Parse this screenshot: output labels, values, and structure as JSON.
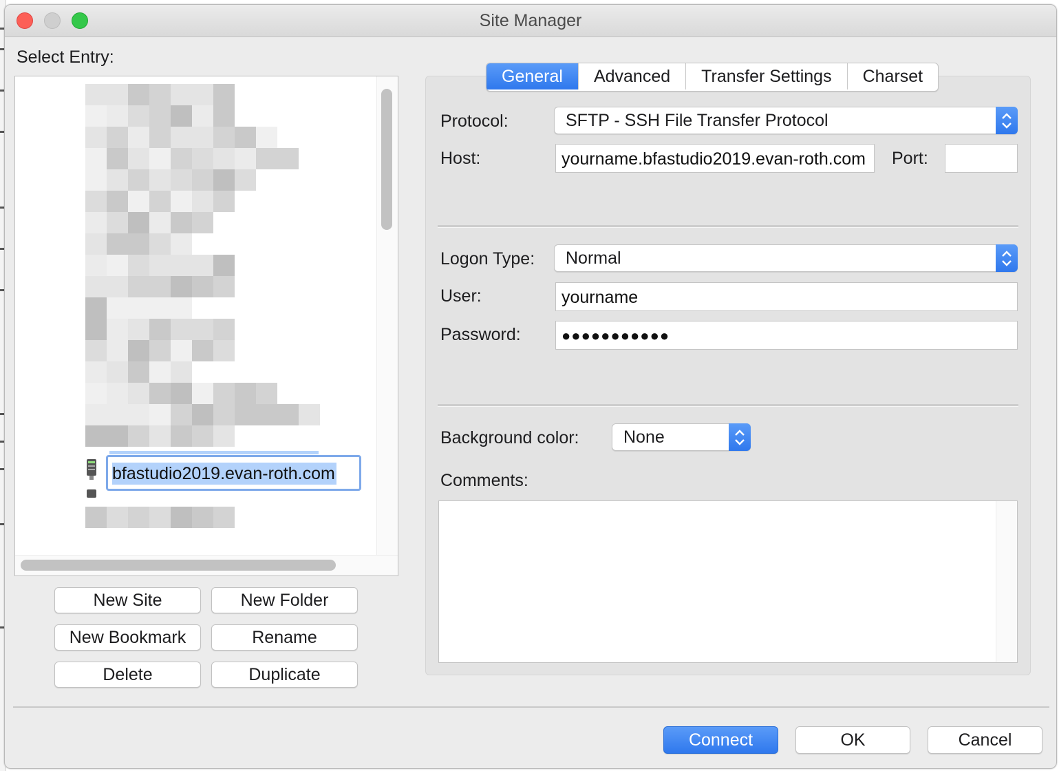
{
  "window": {
    "title": "Site Manager"
  },
  "left": {
    "select_entry_label": "Select Entry:",
    "editing_entry": "bfastudio2019.evan-roth.com"
  },
  "buttons": {
    "new_site": "New Site",
    "new_folder": "New Folder",
    "new_bookmark": "New Bookmark",
    "rename": "Rename",
    "delete": "Delete",
    "duplicate": "Duplicate"
  },
  "tabs": [
    {
      "label": "General",
      "active": true
    },
    {
      "label": "Advanced",
      "active": false
    },
    {
      "label": "Transfer Settings",
      "active": false
    },
    {
      "label": "Charset",
      "active": false
    }
  ],
  "general": {
    "protocol_label": "Protocol:",
    "protocol_value": "SFTP - SSH File Transfer Protocol",
    "host_label": "Host:",
    "host_value": "yourname.bfastudio2019.evan-roth.com",
    "port_label": "Port:",
    "port_value": "",
    "logon_type_label": "Logon Type:",
    "logon_type_value": "Normal",
    "user_label": "User:",
    "user_value": "yourname",
    "password_label": "Password:",
    "password_value": "●●●●●●●●●●●",
    "bg_color_label": "Background color:",
    "bg_color_value": "None",
    "comments_label": "Comments:",
    "comments_value": ""
  },
  "footer": {
    "connect": "Connect",
    "ok": "OK",
    "cancel": "Cancel"
  },
  "colors": {
    "accent": "#2f78ed",
    "selection": "#b3d2fb",
    "window_bg": "#ececec"
  },
  "icons": {
    "server": "server-icon",
    "select_arrows": "chevron-updown-icon"
  }
}
